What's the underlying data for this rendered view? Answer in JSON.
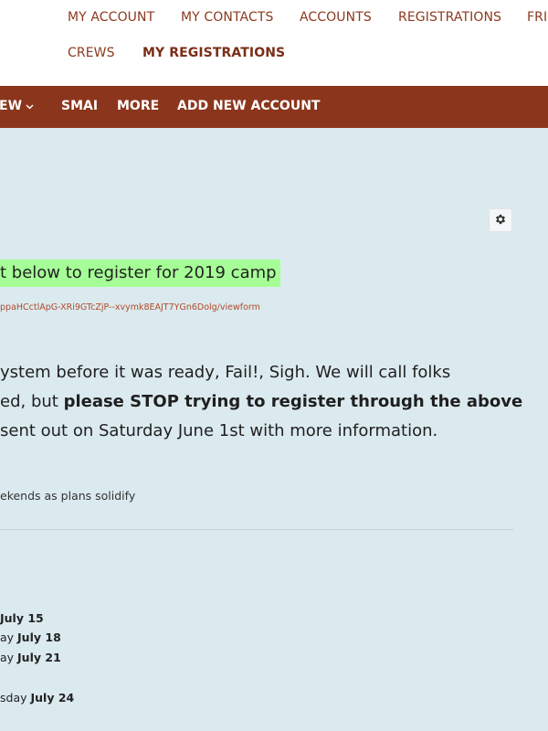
{
  "top_nav": {
    "items": [
      {
        "label": "MY ACCOUNT"
      },
      {
        "label": "MY CONTACTS"
      },
      {
        "label": "ACCOUNTS"
      },
      {
        "label": "REGISTRATIONS"
      },
      {
        "label": "FRI"
      },
      {
        "label": "CREWS"
      },
      {
        "label": "MY REGISTRATIONS",
        "active": true
      }
    ]
  },
  "main_nav": {
    "items": [
      {
        "label": "EW"
      },
      {
        "label": "SMAI"
      },
      {
        "label": "MORE"
      },
      {
        "label": "ADD NEW ACCOUNT"
      }
    ],
    "dropdown_icon": "chevron-down-icon"
  },
  "content": {
    "settings_icon": "gear-icon",
    "headline": "t below to register for 2019 camp",
    "form_link": "ppaHCctlApG-XRi9GTcZjP--xvymk8EAJT7YGn6Dolg/viewform",
    "paragraph": {
      "line1": "ystem before it was ready, Fail!, Sigh. We will call folks",
      "line2_normal": "ed, but ",
      "line2_bold": "please STOP trying to register through the above",
      "line3": "sent out on Saturday June 1st with more information."
    },
    "note": "ekends as plans solidify",
    "dates": [
      {
        "prefix": "",
        "bold": "July 15"
      },
      {
        "prefix": "ay ",
        "bold": "July 18"
      },
      {
        "prefix": "ay ",
        "bold": "July 21"
      },
      {
        "prefix": "sday ",
        "bold": "July 24"
      }
    ]
  },
  "colors": {
    "nav_text": "#8a3a1e",
    "bar_bg": "#8b361c",
    "content_bg": "#dbeaef",
    "highlight": "#a6ff96",
    "link": "#b04a2a"
  }
}
